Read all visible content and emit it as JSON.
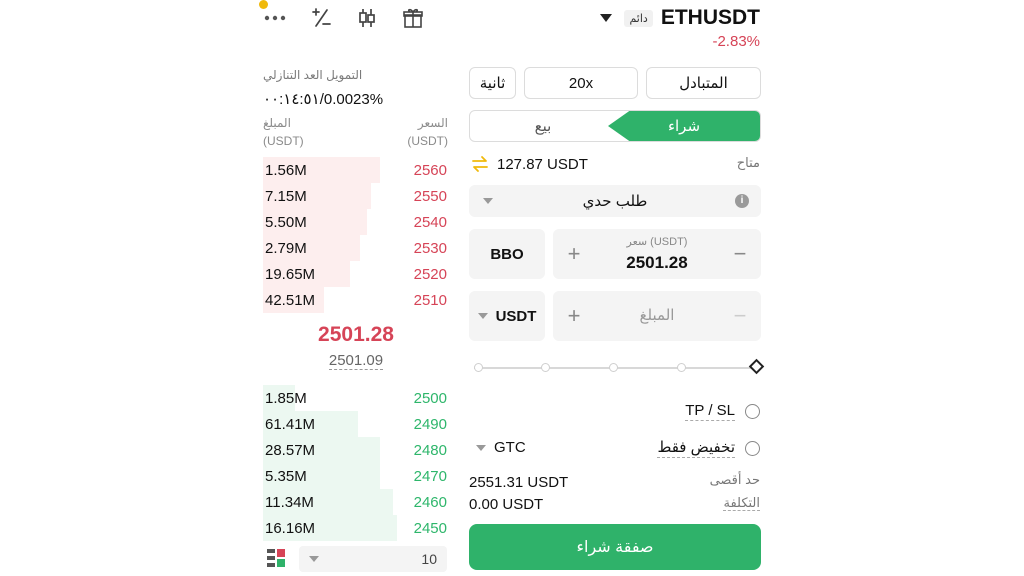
{
  "header": {
    "pair": "ETHUSDT",
    "badge": "دائم",
    "change": "-2.83%",
    "icons": [
      "more-icon",
      "calculator-icon",
      "candlestick-icon",
      "gift-icon"
    ]
  },
  "orderbook": {
    "funding_label": "التمويل  العد التنازلي",
    "funding_value": "٠٠:١٤:٥١/0.0023%",
    "amount_header": "المبلغ",
    "amount_unit": "(USDT)",
    "price_header": "السعر",
    "price_unit": "(USDT)",
    "asks": [
      {
        "amount": "1.56M",
        "price": "2560",
        "depth": 0.63
      },
      {
        "amount": "7.15M",
        "price": "2550",
        "depth": 0.58
      },
      {
        "amount": "5.50M",
        "price": "2540",
        "depth": 0.56
      },
      {
        "amount": "2.79M",
        "price": "2530",
        "depth": 0.52
      },
      {
        "amount": "19.65M",
        "price": "2520",
        "depth": 0.47
      },
      {
        "amount": "42.51M",
        "price": "2510",
        "depth": 0.33
      }
    ],
    "mid_price": "2501.28",
    "mark_price": "2501.09",
    "bids": [
      {
        "amount": "1.85M",
        "price": "2500",
        "depth": 0.17
      },
      {
        "amount": "61.41M",
        "price": "2490",
        "depth": 0.51
      },
      {
        "amount": "28.57M",
        "price": "2480",
        "depth": 0.63
      },
      {
        "amount": "5.35M",
        "price": "2470",
        "depth": 0.63
      },
      {
        "amount": "11.34M",
        "price": "2460",
        "depth": 0.7
      },
      {
        "amount": "16.16M",
        "price": "2450",
        "depth": 0.72
      }
    ],
    "depth_value": "10"
  },
  "order_form": {
    "margin_mode": "المتبادل",
    "leverage": "20x",
    "position_mode": "ثانية",
    "buy_label": "شراء",
    "sell_label": "بيع",
    "available_label": "متاح",
    "available_value": "127.87 USDT",
    "order_type": "طلب حدي",
    "bbo_label": "BBO",
    "price_label": "سعر (USDT)",
    "price_value": "2501.28",
    "amount_placeholder": "المبلغ",
    "amount_unit": "USDT",
    "tpsl_label": "TP / SL",
    "reduce_only_label": "تخفيض فقط",
    "tif_value": "GTC",
    "max_label": "حد أقصى",
    "max_value": "2551.31 USDT",
    "cost_label": "التكلفة",
    "cost_value": "0.00 USDT",
    "submit_label": "صفقة شراء"
  },
  "colors": {
    "buy_green": "#2fb26a",
    "sell_red": "#d64457",
    "accent_yellow": "#f0b90b"
  }
}
